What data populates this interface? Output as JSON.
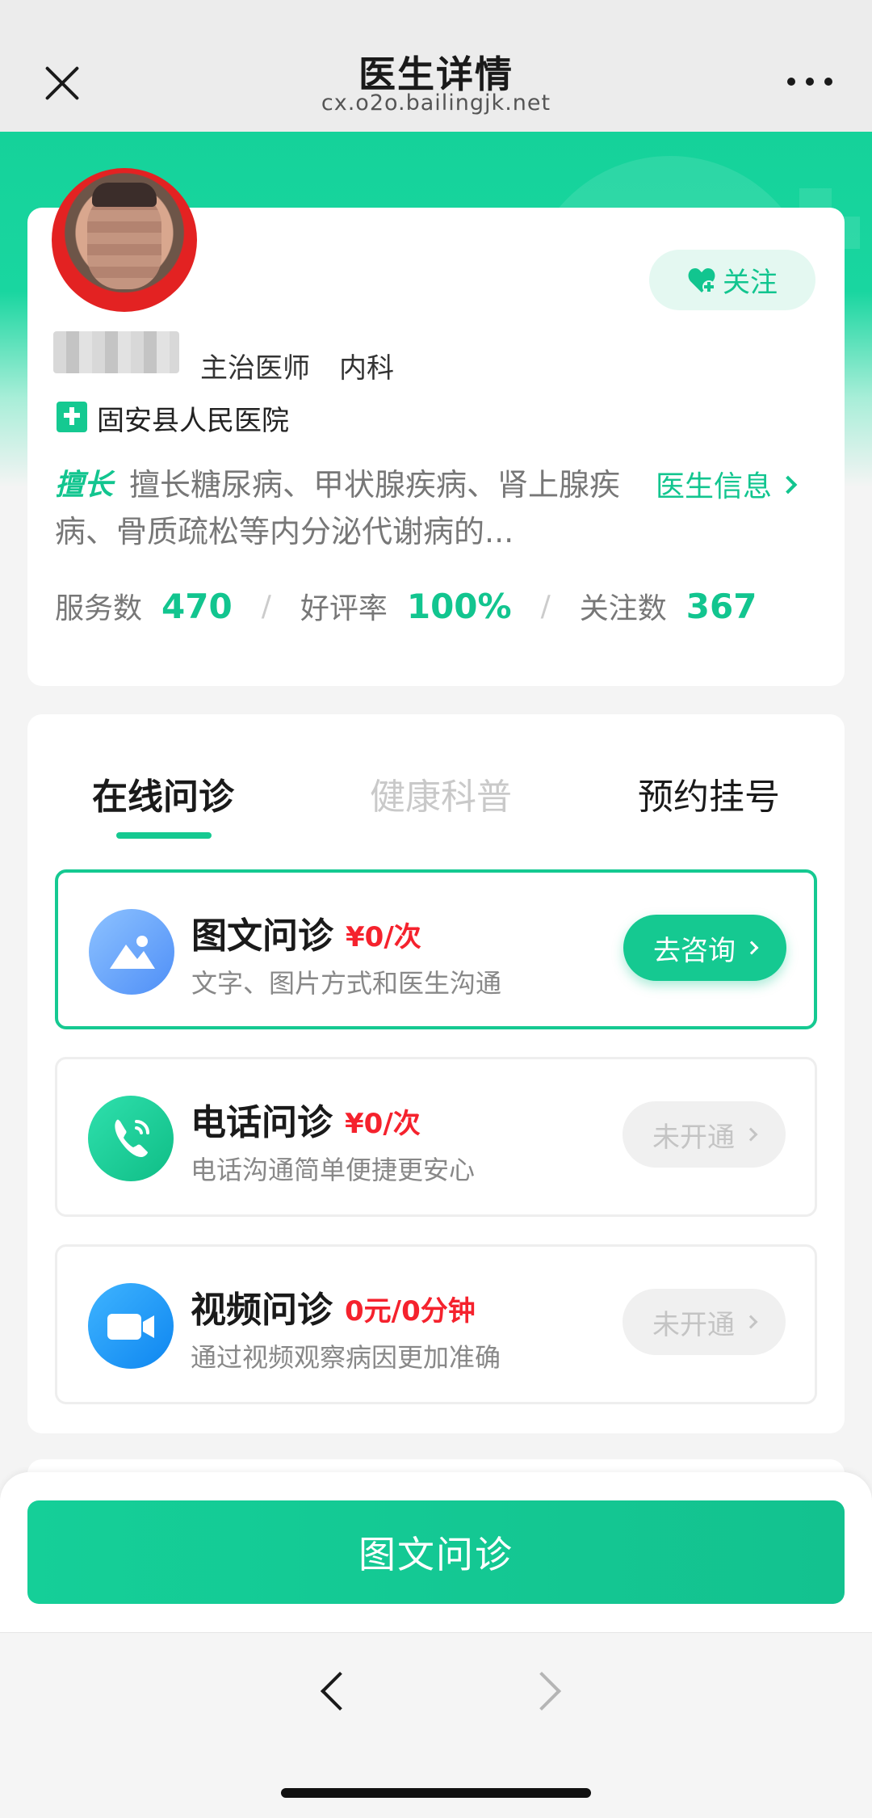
{
  "nav": {
    "title": "医生详情",
    "url": "cx.o2o.bailingjk.net"
  },
  "doctor": {
    "title": "主治医师",
    "department": "内科",
    "hospital": "固安县人民医院",
    "specialty_tag": "擅长",
    "specialty_text": "擅长糖尿病、甲状腺疾病、肾上腺疾病、骨质疏松等内分泌代谢病的...",
    "follow_label": "关注",
    "info_link": "医生信息",
    "stats": {
      "service_label": "服务数",
      "service_value": "470",
      "rating_label": "好评率",
      "rating_value": "100%",
      "followers_label": "关注数",
      "followers_value": "367",
      "separator": "/"
    }
  },
  "tabs": [
    {
      "label": "在线问诊",
      "active": true
    },
    {
      "label": "健康科普",
      "active": false
    },
    {
      "label": "预约挂号",
      "active": false
    }
  ],
  "services": [
    {
      "name": "图文问诊",
      "price": "¥0/次",
      "desc": "文字、图片方式和医生沟通",
      "button": "去咨询",
      "enabled": true,
      "icon": "image-icon"
    },
    {
      "name": "电话问诊",
      "price": "¥0/次",
      "desc": "电话沟通简单便捷更安心",
      "button": "未开通",
      "enabled": false,
      "icon": "phone-icon"
    },
    {
      "name": "视频问诊",
      "price": "0元/0分钟",
      "desc": "通过视频观察病因更加准确",
      "button": "未开通",
      "enabled": false,
      "icon": "video-icon"
    }
  ],
  "primary_button": "图文问诊",
  "colors": {
    "brand_green": "#15c991",
    "price_red": "#f5222d"
  }
}
